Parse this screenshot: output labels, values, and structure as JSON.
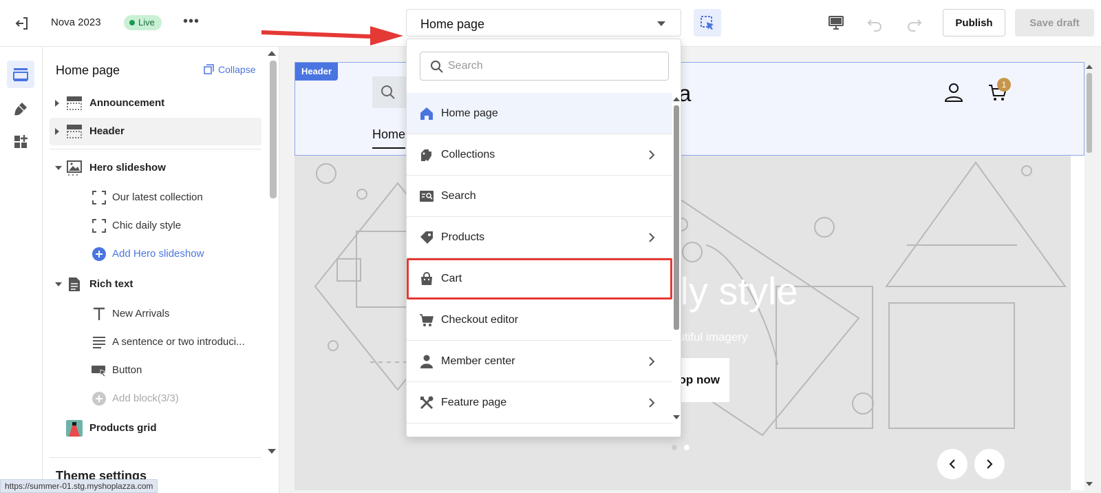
{
  "topbar": {
    "theme_name": "Nova 2023",
    "live_label": "Live",
    "more_label": "•••",
    "page_select_value": "Home page",
    "publish_label": "Publish",
    "save_draft_label": "Save draft"
  },
  "sidebar": {
    "title": "Home page",
    "collapse_label": "Collapse",
    "sections": [
      {
        "label": "Announcement"
      },
      {
        "label": "Header"
      },
      {
        "label": "Hero slideshow"
      },
      {
        "label": "Rich text"
      },
      {
        "label": "Products grid"
      }
    ],
    "hero_blocks": [
      {
        "label": "Our latest collection"
      },
      {
        "label": "Chic daily style"
      },
      {
        "label": "Add Hero slideshow"
      }
    ],
    "rich_text_blocks": [
      {
        "label": "New Arrivals"
      },
      {
        "label": "A sentence or two introduci..."
      },
      {
        "label": "Button"
      },
      {
        "label": "Add block(3/3)"
      }
    ],
    "theme_settings_label": "Theme settings"
  },
  "status_url": "https://summer-01.stg.myshoplazza.com",
  "preview": {
    "header_tag": "Header",
    "logo_text": "plazza",
    "nav_item": "Home",
    "cart_count": "1",
    "hero_title": "ily style",
    "hero_subtitle": "autiful imagery",
    "hero_button": "op now"
  },
  "dropdown": {
    "search_placeholder": "Search",
    "items": [
      {
        "label": "Home page",
        "icon": "home-icon",
        "has_submenu": false
      },
      {
        "label": "Collections",
        "icon": "collections-icon",
        "has_submenu": true
      },
      {
        "label": "Search",
        "icon": "search-page-icon",
        "has_submenu": false
      },
      {
        "label": "Products",
        "icon": "tag-icon",
        "has_submenu": true
      },
      {
        "label": "Cart",
        "icon": "bag-icon",
        "has_submenu": false
      },
      {
        "label": "Checkout editor",
        "icon": "cart-icon",
        "has_submenu": false
      },
      {
        "label": "Member center",
        "icon": "person-icon",
        "has_submenu": true
      },
      {
        "label": "Feature page",
        "icon": "tools-icon",
        "has_submenu": true
      }
    ]
  },
  "colors": {
    "accent": "#4a74e0",
    "live_bg": "#c9f0d5",
    "annotation_red": "#e53935",
    "badge": "#c8964b"
  }
}
